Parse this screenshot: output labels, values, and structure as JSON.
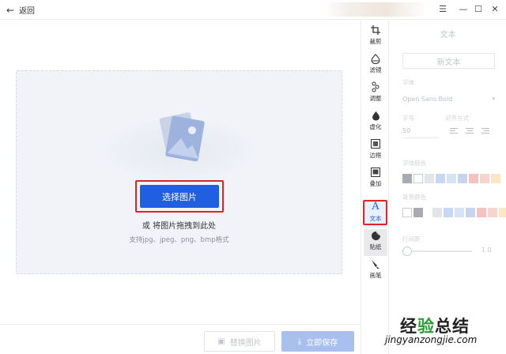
{
  "titlebar": {
    "back_label": "返回",
    "controls": [
      "☰",
      "—",
      "☐",
      "✕"
    ]
  },
  "dropzone": {
    "select_button": "选择图片",
    "drag_hint": "或 将图片拖拽到此处",
    "formats_hint": "支持jpg、jpeg、png、bmp格式"
  },
  "bottombar": {
    "replace_label": "替换图片",
    "save_label": "立即保存"
  },
  "tools": [
    {
      "label": "裁剪",
      "icon": "crop-icon"
    },
    {
      "label": "滤镜",
      "icon": "filter-icon"
    },
    {
      "label": "调整",
      "icon": "adjust-icon"
    },
    {
      "label": "虚化",
      "icon": "blur-icon"
    },
    {
      "label": "边框",
      "icon": "border-icon"
    },
    {
      "label": "叠加",
      "icon": "overlay-icon"
    },
    {
      "label": "文本",
      "icon": "text-icon",
      "active": true
    },
    {
      "label": "贴纸",
      "icon": "sticker-icon"
    },
    {
      "label": "画笔",
      "icon": "brush-icon"
    }
  ],
  "panel": {
    "title": "文本",
    "new_text_button": "新文本",
    "font_label": "字体",
    "font_value": "Open Sans Bold",
    "size_label": "字号",
    "size_value": "50",
    "align_label": "对齐方式",
    "font_color_label": "字体颜色",
    "font_colors": [
      "#a9abb0",
      "#ffffff",
      "#e3e5e9",
      "#c7d7f4",
      "#d5e3f7",
      "#c7d3ef",
      "#f5c2c0",
      "#f8d4cc",
      "#fbe7c5"
    ],
    "bg_color_label": "背景颜色",
    "bg_colors": [
      "#ffffff",
      "#a9abb0",
      "#e3e5e9",
      "#c7d7f4",
      "#d5e3f7",
      "#c7d3ef",
      "#f5c2c0",
      "#f8d4cc",
      "#fbe7c5"
    ],
    "line_spacing_label": "行间距",
    "line_spacing_value": "1.0"
  },
  "watermark": {
    "cn": "经验总结",
    "en": "jingyanzongjie.com"
  }
}
